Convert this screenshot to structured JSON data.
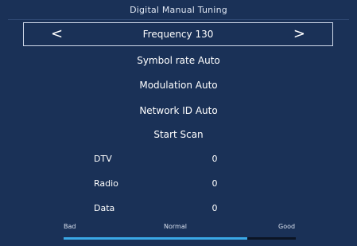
{
  "title": "Digital Manual Tuning",
  "frequency": {
    "label": "Frequency 130",
    "left_arrow": "<",
    "right_arrow": ">"
  },
  "settings": {
    "symbol_rate": "Symbol rate Auto",
    "modulation": "Modulation Auto",
    "network_id": "Network ID Auto",
    "start_scan": "Start Scan"
  },
  "stats": [
    {
      "label": "DTV",
      "value": "0"
    },
    {
      "label": "Radio",
      "value": "0"
    },
    {
      "label": "Data",
      "value": "0"
    }
  ],
  "signal": {
    "bad_label": "Bad",
    "normal_label": "Normal",
    "good_label": "Good",
    "level_fraction": 0.79
  },
  "colors": {
    "background": "#1a3157",
    "signal_fill": "#3aa8e6",
    "signal_track": "#0b1424"
  }
}
